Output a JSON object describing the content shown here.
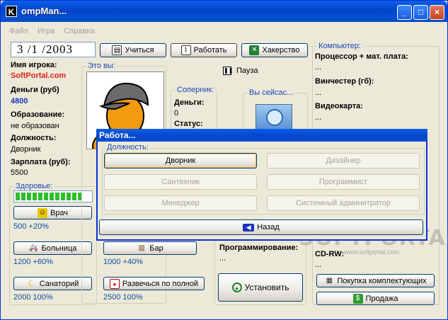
{
  "window": {
    "title": "ompMan...",
    "icon_letter": "K",
    "controls": {
      "minimize": "_",
      "maximize": "□",
      "close": "×"
    }
  },
  "menu": {
    "items": [
      "Файл",
      "Игра",
      "Справка"
    ]
  },
  "date": {
    "value": "3  /1  /2003"
  },
  "toolbar": {
    "study": "Учиться",
    "work": "Работать",
    "hack": "Хакерство"
  },
  "player": {
    "name_label": "Имя игрока:",
    "name_value": "SoftPortal.com",
    "money_label": "Деньги (руб)",
    "money_value": "4800",
    "education_label": "Образование:",
    "education_value": "не образован",
    "position_label": "Должность:",
    "position_value": "Дворник",
    "salary_label": "Зарплата (руб):",
    "salary_value": "5500",
    "health_label": "Здоровье:",
    "health_level": 1.0,
    "health_segments": 12
  },
  "who": {
    "title": "Это вы:"
  },
  "pause": {
    "label": "Пауза"
  },
  "rival": {
    "title": "Соперник:",
    "money_label": "Деньги:",
    "money_value": "0",
    "status_label": "Статус:"
  },
  "now": {
    "title": "Вы сейсас..."
  },
  "computer": {
    "title": "Компьютер:",
    "cpu_label": "Процессор + мат. плата:",
    "cpu_value": "...",
    "hdd_label": "Винчестер (гб):",
    "hdd_value": "...",
    "gpu_label": "Видеокарта:",
    "gpu_value": "...",
    "cdrw_label": "CD-RW:",
    "cdrw_value": "...",
    "buy_parts": "Покупка комплектующих",
    "sell": "Продажа"
  },
  "health_actions": {
    "doctor": "Врач",
    "doctor_cost": "500 +20%",
    "hospital": "Больница",
    "hospital_cost": "1200 +60%",
    "sanatorium": "Санаторий",
    "sanatorium_cost": "2000 100%",
    "bar": "Бар",
    "bar_cost": "1000 +40%",
    "party": "Развечься по полной",
    "party_cost": "2500 100%"
  },
  "programming": {
    "label": "Программирование:",
    "value": "...",
    "install": "Установить"
  },
  "dialog": {
    "title": "Работа...",
    "group_title": "Должность:",
    "jobs": [
      "Дворник",
      "Дизайнер",
      "Сантехник",
      "Программист",
      "Менеджер",
      "Системный админитратор"
    ],
    "back": "Назад"
  },
  "watermark": {
    "text": "SOFTPORTAL",
    "url": "www.softportal.com"
  },
  "colors": {
    "title_blue": "#0444c9",
    "accent_blue": "#1a46b8",
    "red": "#e61e1e",
    "health_green": "#2dbd2d"
  }
}
